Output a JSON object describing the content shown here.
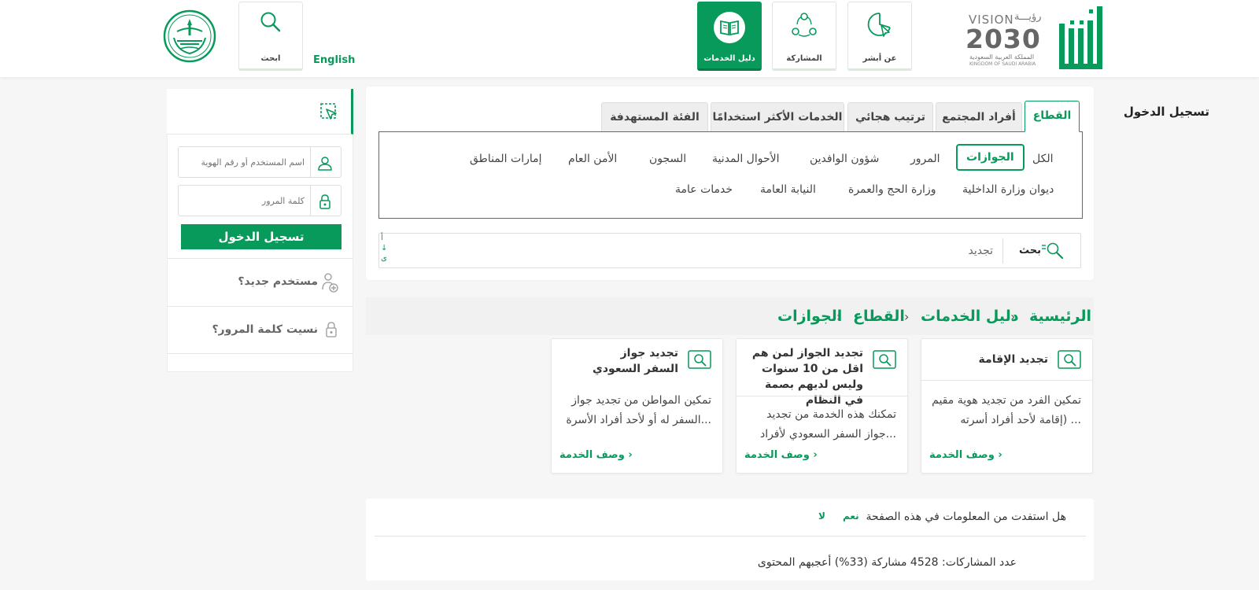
{
  "header": {
    "english_label": "English",
    "search_label": "ابحث",
    "nav": [
      {
        "label": "دليل الخدمات",
        "active": true
      },
      {
        "label": "المشاركة",
        "active": false
      },
      {
        "label": "عن أبشر",
        "active": false
      }
    ],
    "vision": {
      "en": "VISION",
      "ar": "رؤيـــة",
      "year": "2030",
      "kingdom_ar": "المملكة العربية السعودية",
      "kingdom_en": "KINGDOM OF SAUDI ARABIA"
    }
  },
  "tabs": [
    "القطاع",
    "أفراد المجتمع",
    "ترتيب هجائي",
    "الخدمات الأكثر استخدامًا",
    "الفئة المستهدفة"
  ],
  "sectors_row1": [
    "الكل",
    "الجوازات",
    "المرور",
    "شؤون الوافدين",
    "الأحوال المدنية",
    "السجون",
    "الأمن العام",
    "إمارات المناطق"
  ],
  "sectors_row2": [
    "ديوان وزارة الداخلية",
    "وزارة الحج والعمرة",
    "النيابة العامة",
    "خدمات عامة"
  ],
  "search": {
    "label": "بحث",
    "value": "تجديد",
    "az": [
      "أ",
      "↓",
      "ى"
    ]
  },
  "breadcrumb": [
    "الرئيسية",
    "دليل الخدمات",
    "القطاع",
    "الجوازات"
  ],
  "cards": [
    {
      "title": "تجديد الإقامة",
      "desc": "تمكين الفرد من تجديد هوية مقيم (إقامة لأحد أفراد أسرته ...",
      "link": "وصف الخدمة ›"
    },
    {
      "title": "تجديد الجواز لمن هم اقل من 10 سنوات وليس لديهم بصمة في النظام",
      "desc": "تمكنك هذه الخدمة من تجديد جواز السفر السعودي لأفراد...",
      "link": "وصف الخدمة ›"
    },
    {
      "title": "تجديد جواز السفر السعودي",
      "desc": "تمكين المواطن من تجديد جواز السفر له أو لأحد أفراد الأسرة...",
      "link": "وصف الخدمة ›"
    }
  ],
  "feedback": {
    "question": "هل استفدت من المعلومات في هذه الصفحة",
    "yes": "نعم",
    "no": "لا",
    "stats": "عدد المشاركات: 4528 مشاركة (33%) أعجبهم المحتوى"
  },
  "login": {
    "title": "تسجيل الدخول",
    "username_placeholder": "اسم المستخدم أو رقم الهوية",
    "password_placeholder": "كلمة المرور",
    "button": "تسجيل الدخول",
    "new_user": "مستخدم جديد؟",
    "forgot": "نسيت كلمة المرور؟"
  },
  "colors": {
    "accent": "#079a5b",
    "background": "#f6f6f6"
  }
}
